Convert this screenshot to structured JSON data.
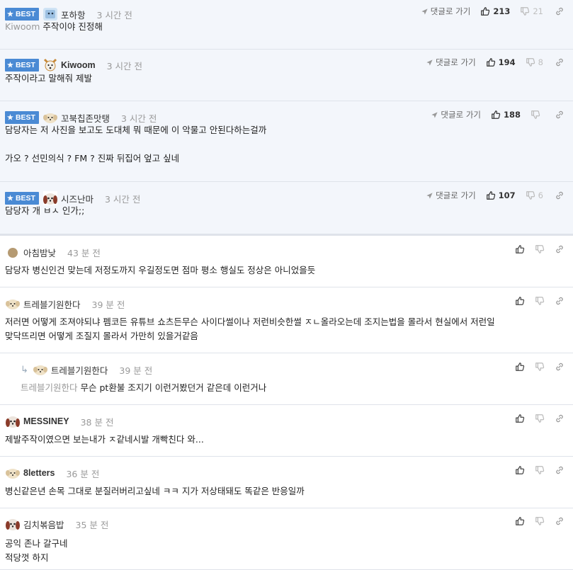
{
  "best_label": "BEST",
  "reply_link_label": "댓글로 가기",
  "best_comments": [
    {
      "nick": "포하항",
      "time": "3 시간 전",
      "likes": "213",
      "dislikes": "21",
      "quote": "Kiwoom",
      "lines": [
        "주작이야 진정해"
      ]
    },
    {
      "nick": "Kiwoom",
      "time": "3 시간 전",
      "likes": "194",
      "dislikes": "8",
      "quote": "",
      "lines": [
        "주작이라고 말해줘 제발"
      ]
    },
    {
      "nick": "꼬북칩존맛탱",
      "time": "3 시간 전",
      "likes": "188",
      "dislikes": "",
      "quote": "",
      "lines": [
        "담당자는 저 사진을 보고도 도대체 뭐 때문에 이 악물고 안된다하는걸까",
        "",
        "가오 ? 선민의식 ? FM ? 진짜 뒤집어 엎고 싶네"
      ]
    },
    {
      "nick": "시즈난마",
      "time": "3 시간 전",
      "likes": "107",
      "dislikes": "6",
      "quote": "",
      "lines": [
        "담당자 개 ㅂㅅ 인가;;"
      ]
    }
  ],
  "comments": [
    {
      "nick": "아침밤낮",
      "time": "43 분 전",
      "quote": "",
      "lines": [
        "담당자 병신인건 맞는데 저정도까지 우길정도면 점마 평소 행실도 정상은 아니었을듯"
      ]
    },
    {
      "nick": "트레블기원한다",
      "time": "39 분 전",
      "quote": "",
      "lines": [
        "저러면 어떻게 조져야되냐 펨코든 유튜브 쇼츠든무슨 사이다썰이나 저런비슷한썰 ㅈㄴ올라오는데 조지는법을 몰라서 현실에서 저런일",
        "맞닥뜨리면 어떻게 조질지 몰라서 가만히 있을거같음"
      ]
    },
    {
      "nick": "트레블기원한다",
      "time": "39 분 전",
      "quote": "트레블기원한다",
      "lines": [
        "무슨 pt환불 조지기 이런거봤던거 같은데 이런거나"
      ]
    },
    {
      "nick": "MESSINEY",
      "time": "38 분 전",
      "quote": "",
      "lines": [
        "제발주작이였으면 보는내가 ㅈ같네시발 개빡친다 와..."
      ]
    },
    {
      "nick": "8letters",
      "time": "36 분 전",
      "quote": "",
      "lines": [
        "병신같은년 손목 그대로 분질러버리고싶네 ㅋㅋ 지가 저상태돼도 똑같은 반응일까"
      ]
    },
    {
      "nick": "김치볶음밥",
      "time": "35 분 전",
      "quote": "",
      "lines": [
        "공익 존나 갈구네",
        "적당껏 하지"
      ]
    }
  ],
  "colors": {
    "best_badge": "#4a8ad4",
    "best_bg": "#f3f6fb",
    "divider": "#dfe3ea",
    "muted": "#9a9a9a"
  },
  "icons": [
    "star-icon",
    "send-arrow-icon",
    "thumb-up-icon",
    "thumb-down-icon",
    "link-icon",
    "reply-arrow-icon",
    "avatar-icon"
  ]
}
